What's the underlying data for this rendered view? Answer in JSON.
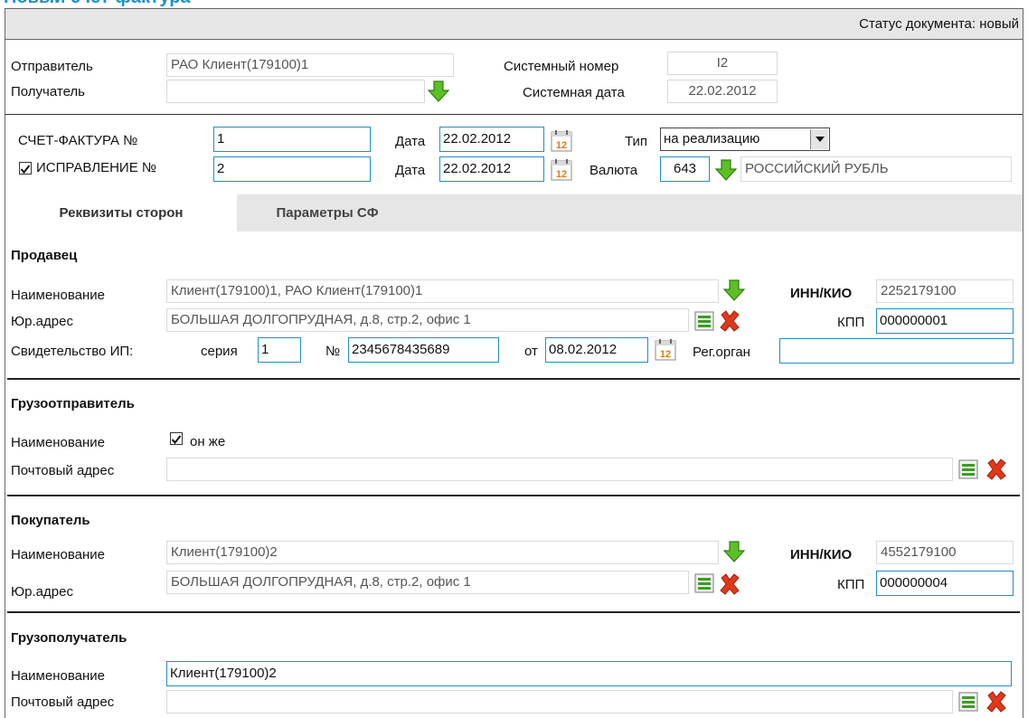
{
  "title": "Новый счет-фактура",
  "status_text": "Статус документа: новый",
  "top": {
    "sender_label": "Отправитель",
    "sender_value": "РАО Клиент(179100)1",
    "receiver_label": "Получатель",
    "receiver_value": "",
    "sysnum_label": "Системный номер",
    "sysnum_value": "I2",
    "sysdate_label": "Системная дата",
    "sysdate_value": "22.02.2012"
  },
  "invoice": {
    "number_label": "СЧЕТ-ФАКТУРА №",
    "number_value": "1",
    "date_label": "Дата",
    "date_value": "22.02.2012",
    "type_label": "Тип",
    "type_value": "на реализацию",
    "correction_label": "ИСПРАВЛЕНИЕ №",
    "correction_checked": true,
    "correction_value": "2",
    "correction_date_label": "Дата",
    "correction_date_value": "22.02.2012",
    "currency_label": "Валюта",
    "currency_code": "643",
    "currency_name": "РОССИЙСКИЙ РУБЛЬ"
  },
  "tabs": [
    {
      "label": "Реквизиты сторон"
    },
    {
      "label": "Параметры СФ"
    }
  ],
  "seller": {
    "header": "Продавец",
    "name_label": "Наименование",
    "name_value": "Клиент(179100)1, РАО Клиент(179100)1",
    "inn_label": "ИНН/КИО",
    "inn_value": "2252179100",
    "address_label": "Юр.адрес",
    "address_value": "БОЛЬШАЯ ДОЛГОПРУДНАЯ, д.8, стр.2, офис 1",
    "kpp_label": "КПП",
    "kpp_value": "000000001",
    "cert_label": "Свидетельство ИП:",
    "series_label": "серия",
    "series_value": "1",
    "no_label": "№",
    "no_value": "2345678435689",
    "from_label": "от",
    "from_value": "08.02.2012",
    "regorgan_label": "Рег.орган",
    "regorgan_value": ""
  },
  "shipper": {
    "header": "Грузоотправитель",
    "name_label": "Наименование",
    "same_label": "он же",
    "same_checked": true,
    "address_label": "Почтовый адрес",
    "address_value": ""
  },
  "buyer": {
    "header": "Покупатель",
    "name_label": "Наименование",
    "name_value": "Клиент(179100)2",
    "inn_label": "ИНН/КИО",
    "inn_value": "4552179100",
    "address_label": "Юр.адрес",
    "address_value": "БОЛЬШАЯ ДОЛГОПРУДНАЯ, д.8, стр.2, офис 1",
    "kpp_label": "КПП",
    "kpp_value": "000000004"
  },
  "consignee": {
    "header": "Грузополучатель",
    "name_label": "Наименование",
    "name_value": "Клиент(179100)2",
    "address_label": "Почтовый адрес",
    "address_value": ""
  },
  "icons": {
    "arrow_down": "green-down-arrow-icon",
    "calendar": "calendar-icon",
    "list": "address-list-icon",
    "clear": "red-x-icon",
    "calendar_day": "12"
  },
  "colors": {
    "accent_blue": "#1f8fc4",
    "title_blue": "#1c8fd0",
    "arrow_green": "#4caf1f",
    "clear_red": "#e2381a"
  }
}
